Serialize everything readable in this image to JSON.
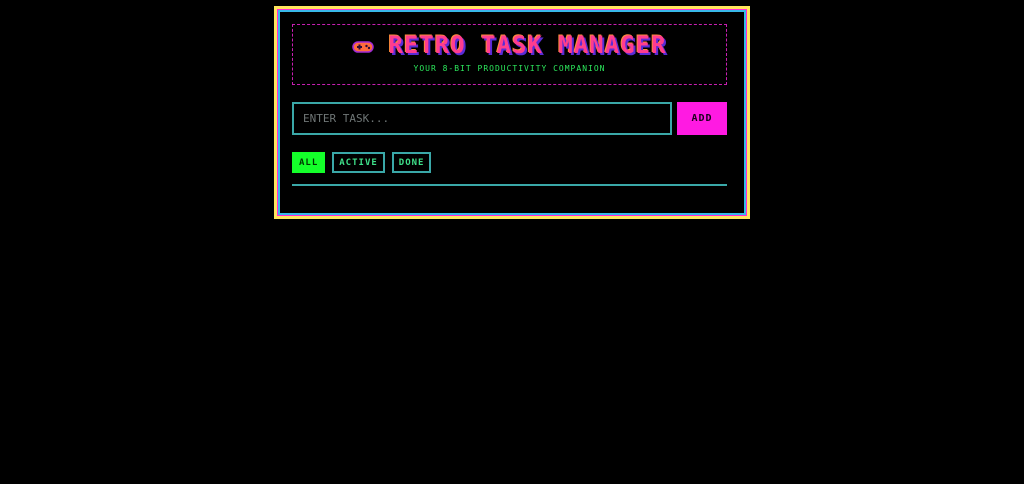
{
  "header": {
    "icon": "gamepad-icon",
    "title": "RETRO TASK MANAGER",
    "subtitle": "YOUR 8-BIT PRODUCTIVITY COMPANION"
  },
  "task_input": {
    "value": "",
    "placeholder": "ENTER TASK..."
  },
  "add_button": {
    "label": "ADD"
  },
  "filters": {
    "items": [
      {
        "label": "ALL",
        "selected": true
      },
      {
        "label": "ACTIVE",
        "selected": false
      },
      {
        "label": "DONE",
        "selected": false
      }
    ]
  },
  "colors": {
    "background": "#000000",
    "frame_outer": "#ffe45c",
    "frame_middle": "#ff2bd6",
    "frame_inner": "#38b8e8",
    "title": "#ff3c8f",
    "subtitle": "#2ce85c",
    "accent_button": "#ff1ae2",
    "filter_selected": "#14ff2a",
    "border_teal": "#3aa8a8"
  }
}
